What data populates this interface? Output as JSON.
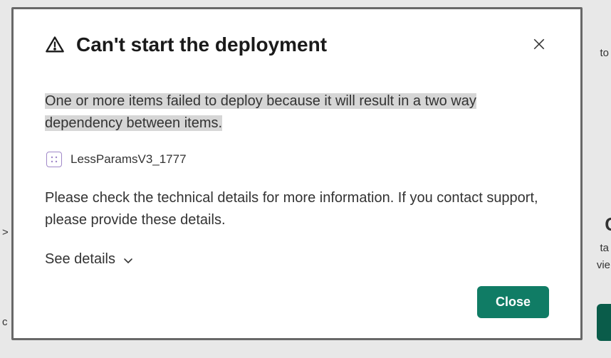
{
  "dialog": {
    "title": "Can't start the deployment",
    "error_message": "One or more items failed to deploy because it will result in a two way dependency between items.",
    "item_name": "LessParamsV3_1777",
    "details_text": "Please check the technical details for more information. If you contact support, please provide these details.",
    "see_details_label": "See details",
    "close_label": "Close"
  },
  "background": {
    "r1": "to",
    "r2": "C",
    "r3": "ta",
    "r4": "vie",
    "l1": ">",
    "l2": "c"
  }
}
